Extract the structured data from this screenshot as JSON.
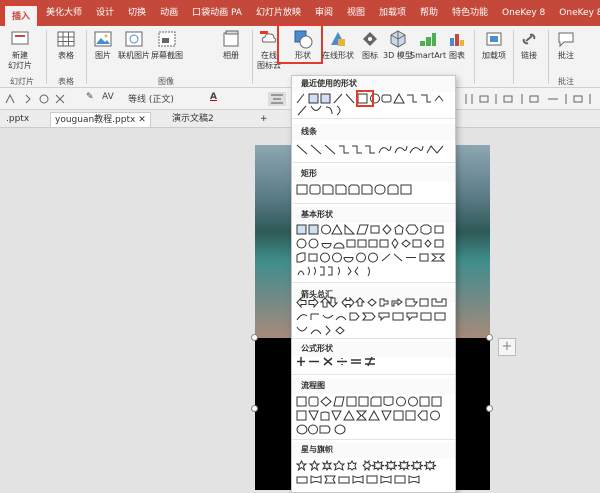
{
  "tabs": [
    "插入",
    "美化大师",
    "设计",
    "切换",
    "动画",
    "口袋动画 PA",
    "幻灯片放映",
    "审阅",
    "视图",
    "加载项",
    "帮助",
    "特色功能",
    "OneKey 8",
    "OneKey 8"
  ],
  "ribbon": {
    "buttons": [
      "表格",
      "图片",
      "联机图片",
      "屏幕截图",
      "相册",
      "在线图标",
      "形状",
      "在线形状",
      "图标",
      "3D 模型",
      "SmartArt",
      "图表",
      "加载项",
      "链接",
      "批注"
    ],
    "new_slide": [
      "新建",
      "幻灯片"
    ],
    "online_icon": [
      "在线",
      "图标云"
    ],
    "groups": [
      "幻灯片",
      "表格",
      "图像",
      "批注"
    ]
  },
  "format_bar": {
    "font": "等线 (正文)",
    "av": "AV",
    "color_a": "A"
  },
  "doc_tabs": [
    ".pptx",
    "youguan教程.pptx",
    "演示文稿2",
    "+"
  ],
  "dropdown": {
    "sections": [
      "最近使用的形状",
      "线条",
      "矩形",
      "基本形状",
      "箭头总汇",
      "公式形状",
      "流程图",
      "星与旗帜"
    ]
  },
  "colors": {
    "accent": "#c4493a",
    "highlight": "#e23b2a"
  },
  "icons": [
    "table-icon",
    "picture-icon",
    "online-picture-icon",
    "screenshot-icon",
    "album-icon",
    "shape-icon",
    "online-shape-icon",
    "icon-icon",
    "3d-model-icon",
    "smartart-icon",
    "chart-icon",
    "addin-icon",
    "link-icon",
    "comment-icon",
    "close-icon"
  ]
}
